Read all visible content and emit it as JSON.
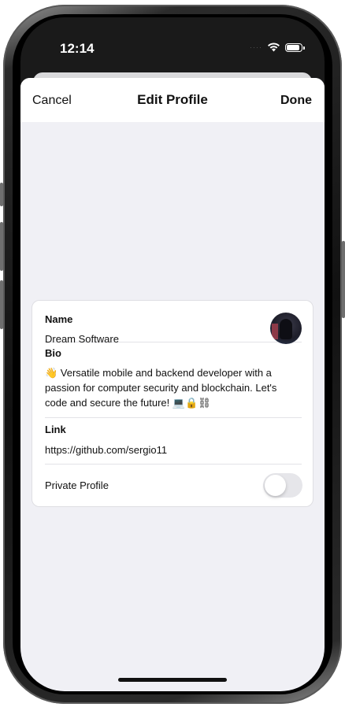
{
  "status_bar": {
    "time": "12:14",
    "icons": [
      "wifi-icon",
      "battery-icon"
    ]
  },
  "nav": {
    "cancel_label": "Cancel",
    "title": "Edit Profile",
    "done_label": "Done"
  },
  "profile": {
    "name_label": "Name",
    "name_value": "Dream Software",
    "bio_label": "Bio",
    "bio_value": "👋 Versatile mobile and backend developer with a passion for computer security and blockchain. Let's code and secure the future! 💻🔒⛓",
    "link_label": "Link",
    "link_value": "https://github.com/sergio11",
    "private_label": "Private Profile",
    "private_enabled": false
  },
  "colors": {
    "sheet_background": "#f0f0f5",
    "card_background": "#ffffff",
    "toggle_off": "#e6e6ea"
  }
}
